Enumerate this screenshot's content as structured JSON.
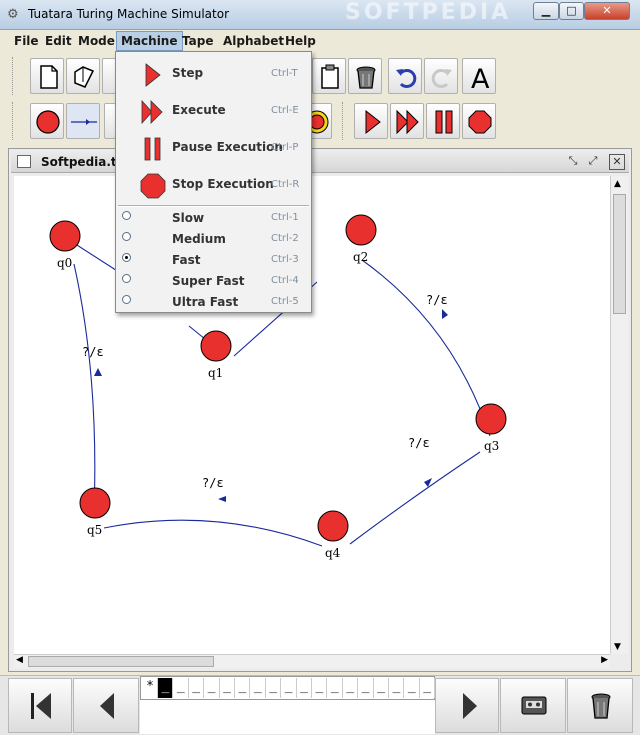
{
  "window": {
    "title": "Tuatara Turing Machine Simulator",
    "watermark": "SOFTPEDIA"
  },
  "menubar": [
    {
      "label": "File",
      "mnemonic": "F"
    },
    {
      "label": "Edit",
      "mnemonic": "E"
    },
    {
      "label": "Mode",
      "mnemonic": "o"
    },
    {
      "label": "Machine",
      "mnemonic": "M"
    },
    {
      "label": "Tape",
      "mnemonic": "T"
    },
    {
      "label": "Alphabet",
      "mnemonic": "A"
    },
    {
      "label": "Help",
      "mnemonic": "H"
    }
  ],
  "machine_menu": {
    "actions": [
      {
        "label": "Step",
        "accel": "Ctrl-T",
        "icon": "step-icon"
      },
      {
        "label": "Execute",
        "accel": "Ctrl-E",
        "icon": "execute-icon"
      },
      {
        "label": "Pause Execution",
        "accel": "Ctrl-P",
        "icon": "pause-icon"
      },
      {
        "label": "Stop Execution",
        "accel": "Ctrl-R",
        "icon": "stop-icon"
      }
    ],
    "speeds": [
      {
        "label": "Slow",
        "accel": "Ctrl-1",
        "selected": false
      },
      {
        "label": "Medium",
        "accel": "Ctrl-2",
        "selected": false
      },
      {
        "label": "Fast",
        "accel": "Ctrl-3",
        "selected": true
      },
      {
        "label": "Super Fast",
        "accel": "Ctrl-4",
        "selected": false
      },
      {
        "label": "Ultra Fast",
        "accel": "Ctrl-5",
        "selected": false
      }
    ]
  },
  "document": {
    "title": "Softpedia.tm",
    "states": [
      "q0",
      "q1",
      "q2",
      "q3",
      "q4",
      "q5"
    ],
    "transition_label": "?/ε"
  },
  "tape": {
    "cells": [
      "*",
      "_",
      "_",
      "_",
      "_",
      "_",
      "_",
      "_",
      "_",
      "_",
      "_",
      "_",
      "_",
      "_",
      "_",
      "_",
      "_",
      "_",
      "_"
    ],
    "head_index": 1
  },
  "colors": {
    "state_fill": "#e8302f",
    "edge": "#1a2a9c",
    "menu_highlight": "#b8cfe5"
  }
}
